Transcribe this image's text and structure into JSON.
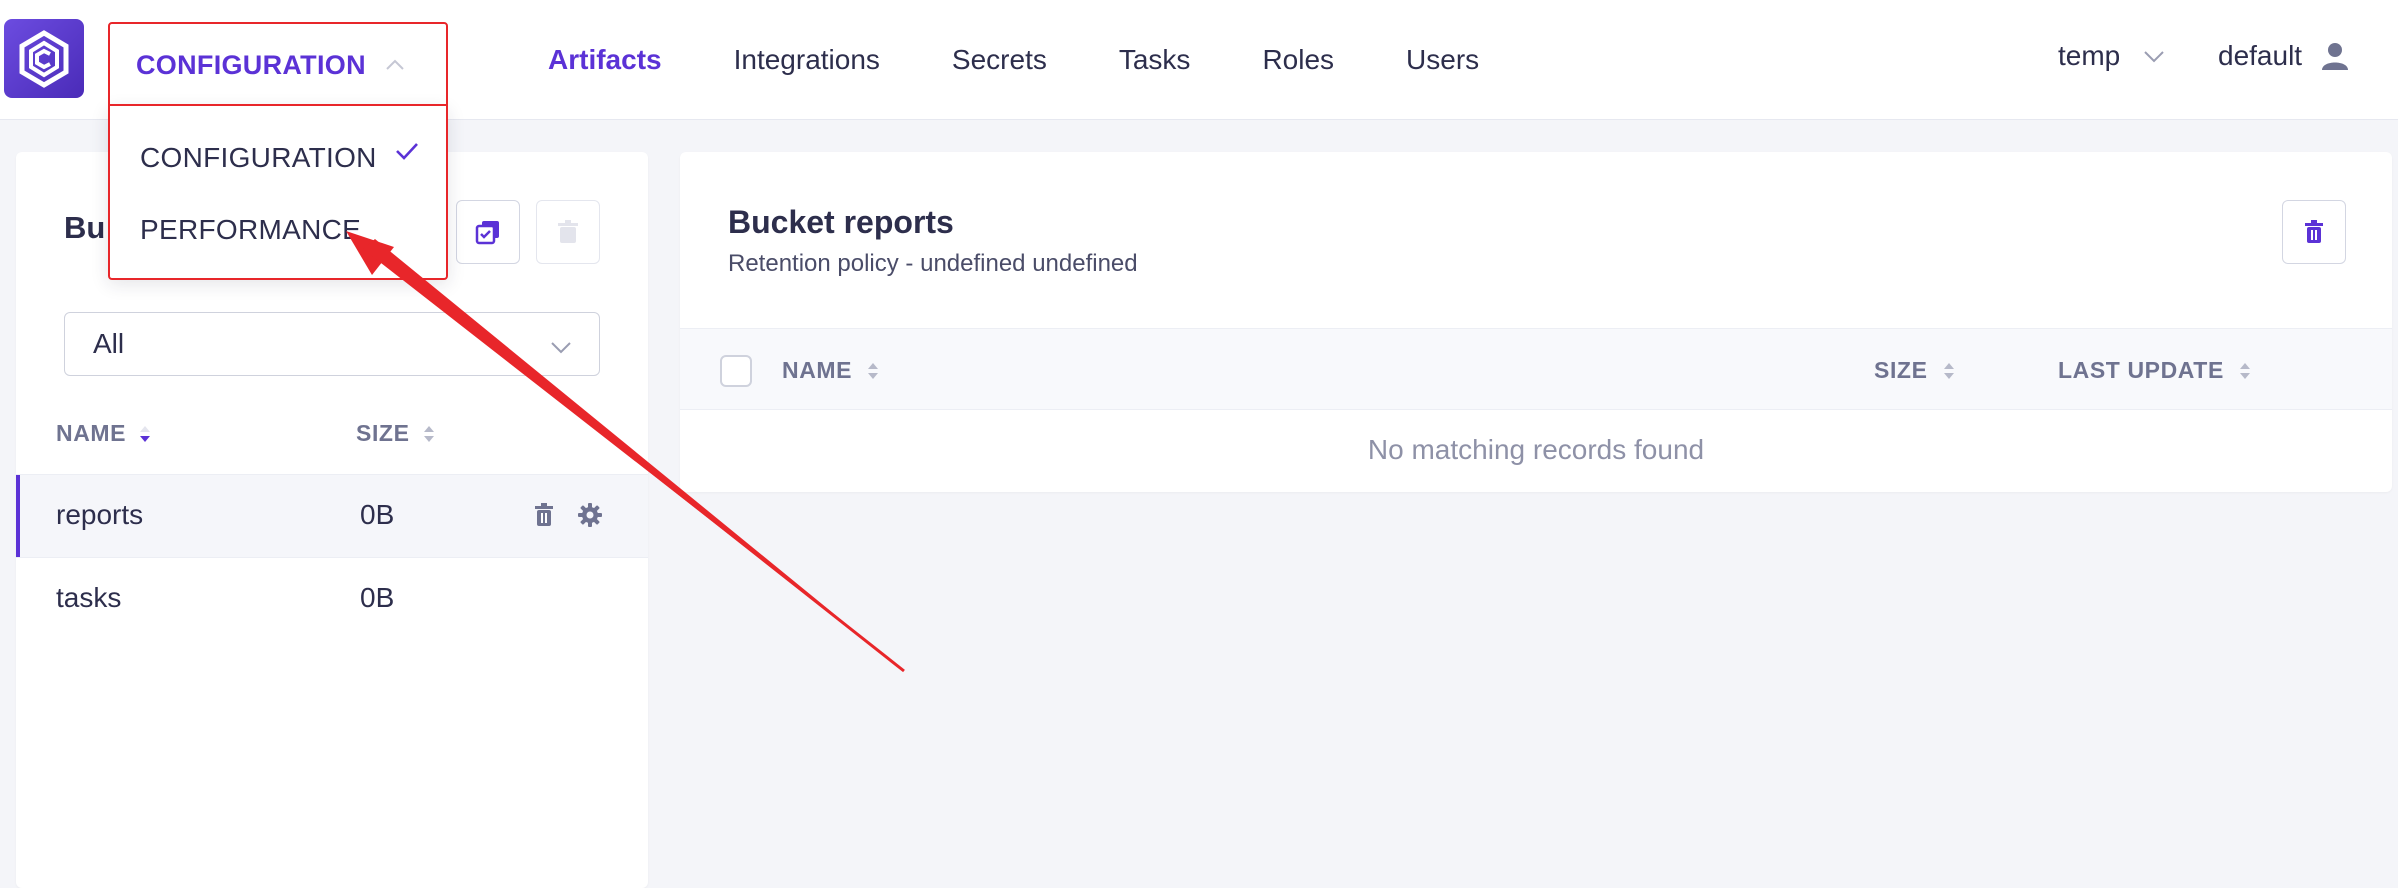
{
  "header": {
    "mode_label": "CONFIGURATION",
    "nav": [
      "Artifacts",
      "Integrations",
      "Secrets",
      "Tasks",
      "Roles",
      "Users"
    ],
    "active_nav": "Artifacts",
    "bucket": "temp",
    "user": "default"
  },
  "dropdown": {
    "items": [
      "CONFIGURATION",
      "PERFORMANCE"
    ],
    "selected": "CONFIGURATION"
  },
  "left_panel": {
    "title_partial": "Bu",
    "filter_value": "All",
    "columns": {
      "name": "NAME",
      "size": "SIZE"
    },
    "rows": [
      {
        "name": "reports",
        "size": "0B",
        "selected": true
      },
      {
        "name": "tasks",
        "size": "0B",
        "selected": false
      }
    ]
  },
  "right_panel": {
    "title": "Bucket reports",
    "subtitle": "Retention policy - undefined undefined",
    "columns": {
      "name": "NAME",
      "size": "SIZE",
      "last_update": "LAST UPDATE"
    },
    "empty_message": "No matching records found"
  },
  "colors": {
    "accent": "#5b32d6",
    "annotation": "#e8262a",
    "background": "#f4f5f9"
  }
}
